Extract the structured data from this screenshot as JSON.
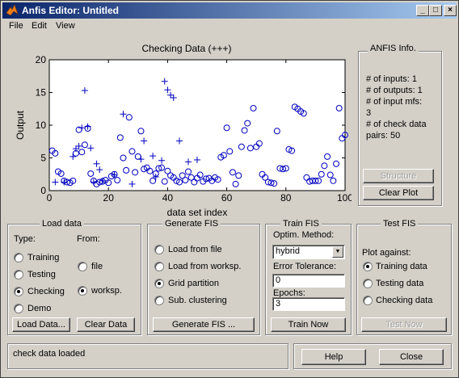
{
  "window": {
    "title": "Anfis Editor: Untitled",
    "controls": [
      "_",
      "□",
      "×"
    ]
  },
  "menu": [
    "File",
    "Edit",
    "View"
  ],
  "plot": {
    "title": "Checking Data (+++)",
    "xlabel": "data set index",
    "ylabel": "Output",
    "xticks": [
      "0",
      "20",
      "40",
      "60",
      "80",
      "100"
    ],
    "yticks": [
      "0",
      "5",
      "10",
      "15",
      "20"
    ]
  },
  "chart_data": {
    "type": "scatter",
    "title": "Checking Data (+++)",
    "xlabel": "data set index",
    "ylabel": "Output",
    "xlim": [
      0,
      100
    ],
    "ylim": [
      0,
      20
    ],
    "grid": false,
    "series": [
      {
        "name": "",
        "marker": "plus",
        "x": [
          2,
          5,
          8,
          9,
          10,
          11,
          12,
          13,
          14,
          15,
          16,
          17,
          18,
          22,
          25,
          28,
          31,
          32,
          35,
          36,
          38,
          39,
          40,
          41,
          42,
          44,
          47,
          50
        ],
        "y": [
          1.3,
          1.3,
          5.2,
          6.4,
          6.8,
          9.6,
          15.3,
          9.8,
          6.5,
          1.3,
          4.1,
          3.2,
          1.5,
          2.4,
          11.7,
          1.0,
          4.8,
          7.6,
          5.3,
          2.1,
          4.6,
          16.7,
          15.4,
          14.6,
          14.2,
          7.6,
          4.4,
          4.7
        ]
      },
      {
        "name": "",
        "marker": "circle",
        "x": [
          1,
          2,
          3,
          4,
          5,
          6,
          7,
          8,
          9,
          10,
          11,
          12,
          13,
          14,
          15,
          16,
          17,
          18,
          19,
          20,
          21,
          22,
          23,
          24,
          25,
          26,
          27,
          28,
          29,
          30,
          31,
          32,
          33,
          34,
          35,
          36,
          37,
          38,
          39,
          40,
          41,
          42,
          43,
          44,
          45,
          46,
          47,
          48,
          49,
          50,
          51,
          52,
          53,
          54,
          55,
          56,
          57,
          58,
          59,
          60,
          61,
          62,
          63,
          64,
          65,
          66,
          67,
          68,
          69,
          70,
          71,
          72,
          73,
          74,
          75,
          76,
          77,
          78,
          79,
          80,
          81,
          82,
          83,
          84,
          85,
          86,
          87,
          88,
          89,
          90,
          91,
          92,
          93,
          94,
          95,
          96,
          97,
          98,
          99,
          100
        ],
        "y": [
          6.1,
          5.7,
          2.9,
          2.6,
          1.5,
          1.3,
          1.2,
          1.5,
          5.7,
          9.3,
          5.9,
          7.0,
          9.5,
          2.6,
          1.5,
          1.0,
          1.3,
          1.4,
          1.6,
          1.2,
          2.2,
          2.5,
          1.6,
          8.1,
          5.0,
          3.1,
          11.2,
          6.0,
          2.8,
          5.2,
          9.1,
          3.3,
          3.5,
          3.0,
          1.5,
          2.6,
          3.4,
          3.5,
          1.4,
          3.0,
          2.3,
          2.0,
          1.5,
          1.3,
          2.3,
          1.6,
          2.9,
          2.0,
          1.3,
          1.9,
          2.4,
          1.4,
          1.8,
          1.9,
          1.5,
          2.0,
          1.7,
          5.1,
          5.4,
          9.6,
          6.0,
          2.8,
          1.0,
          2.3,
          6.7,
          9.2,
          10.3,
          6.5,
          12.6,
          6.7,
          7.2,
          2.5,
          2.0,
          1.3,
          1.2,
          1.1,
          9.1,
          3.4,
          3.3,
          3.4,
          6.3,
          6.1,
          12.8,
          12.5,
          12.1,
          11.8,
          2.0,
          1.4,
          1.5,
          1.5,
          1.5,
          2.5,
          3.8,
          5.2,
          2.4,
          1.5,
          4.1,
          12.6,
          8.0,
          8.5
        ]
      }
    ]
  },
  "info_panel": {
    "title": "ANFIS Info.",
    "lines": [
      "# of inputs: 1",
      "# of outputs: 1",
      "# of input mfs:",
      "3",
      "# of check data",
      "pairs: 50"
    ],
    "structure_button": "Structure",
    "clear_plot_button": "Clear Plot"
  },
  "load_data": {
    "title": "Load data",
    "type_label": "Type:",
    "from_label": "From:",
    "types": [
      "Training",
      "Testing",
      "Checking",
      "Demo"
    ],
    "type_selected": "Checking",
    "sources": [
      "file",
      "worksp."
    ],
    "source_selected": "worksp.",
    "load_button": "Load Data...",
    "clear_button": "Clear Data"
  },
  "generate_fis": {
    "title": "Generate FIS",
    "options": [
      "Load from file",
      "Load from worksp.",
      "Grid partition",
      "Sub. clustering"
    ],
    "selected": "Grid partition",
    "button": "Generate FIS ..."
  },
  "train_fis": {
    "title": "Train FIS",
    "method_label": "Optim. Method:",
    "method_value": "hybrid",
    "tolerance_label": "Error Tolerance:",
    "tolerance_value": "0",
    "epochs_label": "Epochs:",
    "epochs_value": "3",
    "button": "Train Now"
  },
  "test_fis": {
    "title": "Test FIS",
    "plot_against_label": "Plot against:",
    "options": [
      "Training data",
      "Testing data",
      "Checking data"
    ],
    "selected": "Training data",
    "button": "Test Now"
  },
  "status": {
    "text": "check data loaded"
  },
  "footer": {
    "help_button": "Help",
    "close_button": "Close"
  },
  "colors": {
    "marker": "#0000c0",
    "titlebar_start": "#0a246a",
    "titlebar_end": "#a6caf0",
    "face": "#d4d0c8"
  }
}
